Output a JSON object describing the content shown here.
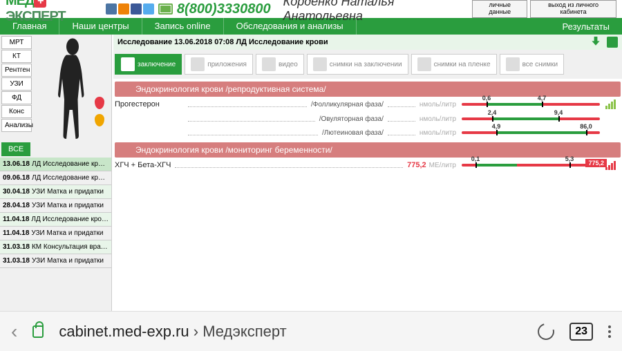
{
  "header": {
    "logo_med": "МЕД",
    "logo_exp": "ЭКСПЕРТ",
    "phone": "8(800)3330800",
    "user": "Корденко Наталья Анатольевна",
    "btn_profile": "личные данные",
    "btn_logout": "выход из личного кабинета"
  },
  "nav": {
    "items": [
      "Главная",
      "Наши центры",
      "Запись online",
      "Обследования и анализы"
    ],
    "results": "Результаты"
  },
  "cats": [
    "МРТ",
    "КТ",
    "Рентген",
    "УЗИ",
    "ФД",
    "Конс",
    "Анализы"
  ],
  "all_btn": "ВСЕ",
  "history": [
    {
      "date": "13.06.18",
      "desc": "ЛД Исследование крови",
      "cls": "active"
    },
    {
      "date": "09.06.18",
      "desc": "ЛД Исследование крови",
      "cls": ""
    },
    {
      "date": "30.04.18",
      "desc": "УЗИ Матка и придатки",
      "cls": "alt"
    },
    {
      "date": "28.04.18",
      "desc": "УЗИ Матка и придатки",
      "cls": ""
    },
    {
      "date": "11.04.18",
      "desc": "ЛД Исследование крови",
      "cls": "alt"
    },
    {
      "date": "11.04.18",
      "desc": "УЗИ Матка и придатки",
      "cls": ""
    },
    {
      "date": "31.03.18",
      "desc": "КМ Консультация врача-г...",
      "cls": "alt"
    },
    {
      "date": "31.03.18",
      "desc": "УЗИ Матка и придатки",
      "cls": ""
    }
  ],
  "title": "Исследование 13.06.2018 07:08 ЛД Исследование крови",
  "tabs": [
    {
      "label": "заключение",
      "active": true
    },
    {
      "label": "приложения",
      "active": false
    },
    {
      "label": "видео",
      "active": false
    },
    {
      "label": "снимки на заключении",
      "active": false
    },
    {
      "label": "снимки на пленке",
      "active": false
    },
    {
      "label": "все снимки",
      "active": false
    }
  ],
  "section1": "Эндокринология крови /репродуктивная система/",
  "section2": "Эндокринология крови /мониторинг беременности/",
  "progesterone": {
    "name": "Прогестерон",
    "phases": [
      {
        "phase": "/Фолликулярная фаза/",
        "unit": "нмоль/литр",
        "lo": "0,6",
        "hi": "4,7"
      },
      {
        "phase": "/Овуляторная фаза/",
        "unit": "нмоль/литр",
        "lo": "2,4",
        "hi": "9,4"
      },
      {
        "phase": "/Лютеиновая фаза/",
        "unit": "нмоль/литр",
        "lo": "4,9",
        "hi": "86,0"
      }
    ]
  },
  "hcg": {
    "name": "ХГЧ + Бета-ХГЧ",
    "value": "775,2",
    "unit": "МЕ/литр",
    "lo": "0,1",
    "hi": "5,3",
    "badge": "775,2"
  },
  "browser": {
    "domain": "cabinet.med-exp.ru",
    "sep": " › ",
    "site": "Медэксперт",
    "tabs": "23"
  }
}
